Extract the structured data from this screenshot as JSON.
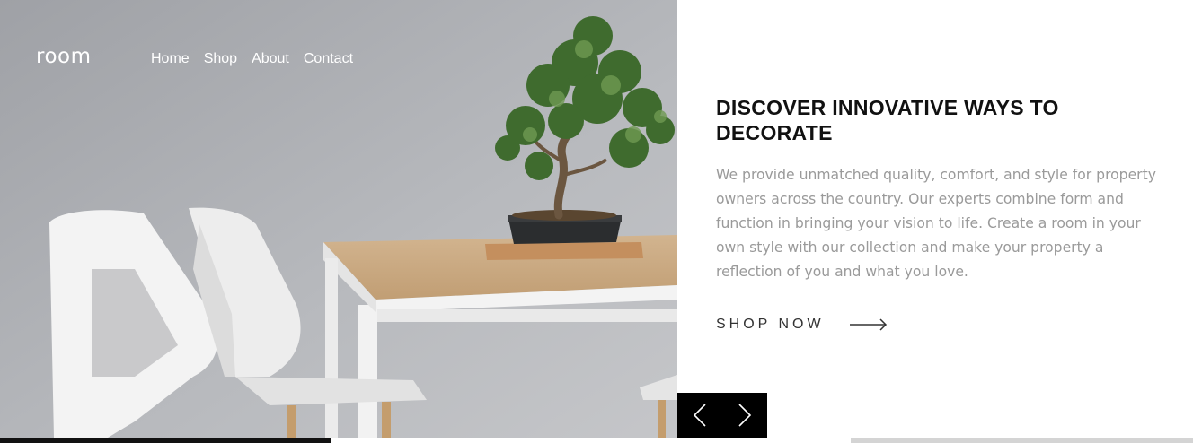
{
  "brand": {
    "logo": "room"
  },
  "nav": {
    "items": [
      {
        "label": "Home"
      },
      {
        "label": "Shop"
      },
      {
        "label": "About"
      },
      {
        "label": "Contact"
      }
    ]
  },
  "hero": {
    "headline": "DISCOVER INNOVATIVE WAYS TO DECORATE",
    "description": "We provide unmatched quality, comfort, and style for property owners across the country. Our experts combine form and function in bringing your vision to life. Create a room in your own style with our collection and make your property a reflection of you and what you love.",
    "cta_label": "SHOP NOW",
    "cta_icon": "arrow-right-icon"
  },
  "slider": {
    "prev_icon": "chevron-left-icon",
    "next_icon": "chevron-right-icon"
  },
  "colors": {
    "headline": "#111111",
    "body_text": "#9a9a9a",
    "controls_bg": "#000000",
    "nav_text": "#ffffff"
  }
}
